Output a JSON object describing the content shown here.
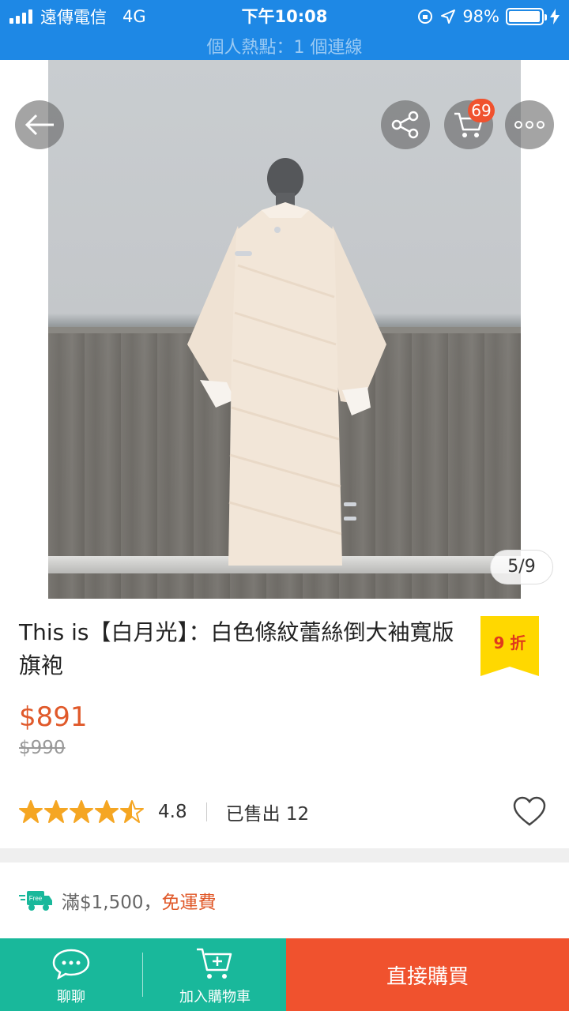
{
  "status_bar": {
    "carrier": "遠傳電信",
    "network": "4G",
    "time": "下午10:08",
    "battery_percent": "98%",
    "battery_level": 0.98,
    "hotspot": "個人熱點：1 個連線"
  },
  "gallery": {
    "page_indicator": "5/9",
    "cart_count": "69"
  },
  "product": {
    "title": "This is【白月光】：白色條紋蕾絲倒大袖寬版旗袍",
    "discount": "9 折",
    "price": "$891",
    "original_price": "$990",
    "rating": "4.8",
    "rating_value": 4.5,
    "sold": "已售出 12"
  },
  "shipping": {
    "badge": "Free",
    "threshold": "滿$1,500，",
    "free_label": "免運費"
  },
  "bottom_bar": {
    "chat": "聊聊",
    "add_to_cart": "加入購物車",
    "buy_now": "直接購買"
  },
  "colors": {
    "status_bar": "#1e88e5",
    "price": "#e0592a",
    "teal": "#19b89b",
    "buy_now": "#f0522e",
    "discount_tag": "#ffd800",
    "star": "#f5a623"
  }
}
